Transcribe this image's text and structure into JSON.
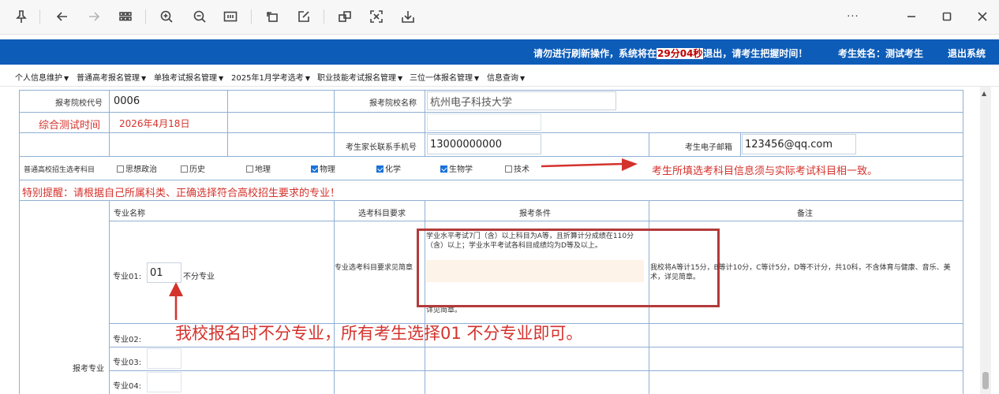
{
  "toolbar": {
    "icons": [
      "pin-icon",
      "back-icon",
      "forward-icon",
      "apps-grid-icon",
      "zoom-in-icon",
      "zoom-out-icon",
      "fit-page-icon",
      "rotate-icon",
      "edit-icon",
      "copy-icon",
      "screenshot-icon",
      "save-icon",
      "more-icon",
      "minimize-icon",
      "maximize-icon",
      "close-icon"
    ],
    "more_label": "···"
  },
  "banner": {
    "notice_prefix": "请勿进行刷新操作，系统将在",
    "countdown": "29分04秒",
    "notice_suffix": "退出，请考生把握时间！",
    "candidate_label": "考生姓名：测试考生",
    "logout": "退出系统",
    "color": "#0d5cb8"
  },
  "menu": [
    {
      "label": "个人信息维护"
    },
    {
      "label": "普通高考报名管理"
    },
    {
      "label": "单独考试报名管理"
    },
    {
      "label": "2025年1月学考选考"
    },
    {
      "label": "职业技能考试报名管理"
    },
    {
      "label": "三位一体报名管理"
    },
    {
      "label": "信息查询"
    }
  ],
  "form": {
    "school_code_label": "报考院校代号",
    "school_code": "0006",
    "school_name_label": "报考院校名称",
    "school_name": "杭州电子科技大学",
    "test_time_label": "综合测试时间",
    "test_time": "2026年4月18日",
    "parent_phone_label": "考生家长联系手机号",
    "parent_phone": "13000000000",
    "email_label": "考生电子邮箱",
    "email": "123456@qq.com",
    "subjects_label": "普通高校招生选考科目",
    "subjects": [
      {
        "label": "思想政治",
        "checked": false
      },
      {
        "label": "历史",
        "checked": false
      },
      {
        "label": "地理",
        "checked": false
      },
      {
        "label": "物理",
        "checked": true
      },
      {
        "label": "化学",
        "checked": true
      },
      {
        "label": "生物学",
        "checked": true
      },
      {
        "label": "技术",
        "checked": false
      }
    ],
    "subjects_note": "考生所填选考科目信息须与实际考试科目相一致。",
    "reminder": "特别提醒：请根据自己所属科类、正确选择符合高校招生要求的专业！",
    "major_headers": {
      "name": "专业名称",
      "subject_req": "选考科目要求",
      "condition": "报考条件",
      "remarks": "备注"
    },
    "major_section_label": "报考专业",
    "majors": [
      {
        "label": "专业01:",
        "value": "01",
        "name": "不分专业"
      },
      {
        "label": "专业02:",
        "value": "",
        "name": ""
      },
      {
        "label": "专业03:",
        "value": "",
        "name": ""
      },
      {
        "label": "专业04:",
        "value": "",
        "name": ""
      }
    ],
    "subject_req_text": "专业选考科目要求见简章",
    "condition_text": "学业水平考试7门（含）以上科目为A等，且折算计分成绩在110分（含）以上；学业水平考试各科目成绩均为D等及以上。",
    "condition_more": "详见简章。",
    "remarks_text": "我校将A等计15分，B等计10分，C等计5分，D等不计分，共10科，不含体育与健康、音乐、美术，详见简章。",
    "annotation": "我校报名时不分专业，所有考生选择01 不分专业即可。",
    "annotation_color": "#d4322c"
  }
}
